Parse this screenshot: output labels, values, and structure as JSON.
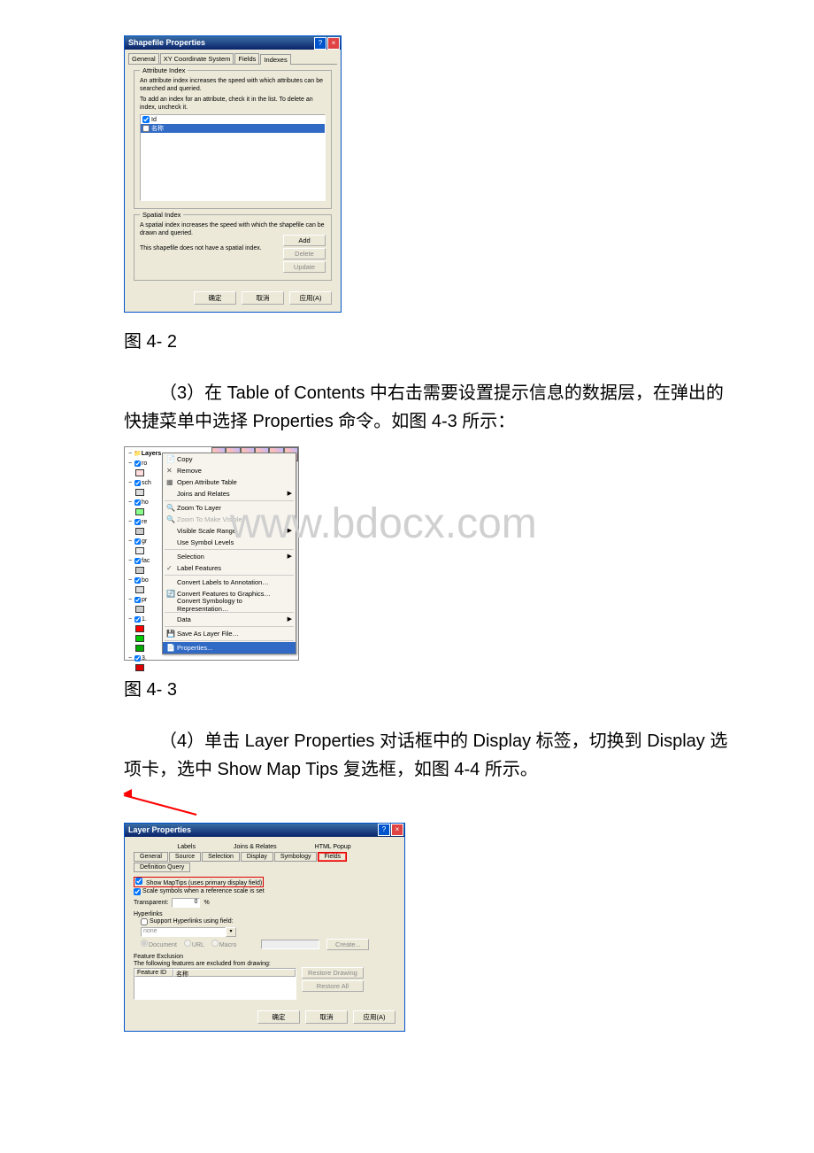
{
  "watermark": "www.bdocx.com",
  "captions": {
    "fig1": "图 4- 2",
    "fig2": "图 4- 3"
  },
  "para1": "（3）在 Table of Contents 中右击需要设置提示信息的数据层，在弹出的快捷菜单中选择 Properties 命令。如图 4-3 所示：",
  "para2": "（4）单击 Layer Properties 对话框中的 Display 标签，切换到 Display 选项卡，选中 Show Map Tips 复选框，如图 4-4 所示。",
  "dlg1": {
    "title": "Shapefile Properties",
    "tabs": {
      "t1": "General",
      "t2": "XY Coordinate System",
      "t3": "Fields",
      "t4": "Indexes"
    },
    "attr_legend": "Attribute Index",
    "attr_desc1": "An attribute index increases the speed with which attributes can be searched and queried.",
    "attr_desc2": "To add an index for an attribute, check it in the list. To delete an index, uncheck it.",
    "li1": "Id",
    "li2": "名称",
    "sp_legend": "Spatial Index",
    "sp_desc": "A spatial index increases the speed with which the shapefile can be drawn and queried.",
    "sp_status": "This shapefile does not have a spatial index.",
    "btn_add": "Add",
    "btn_delete": "Delete",
    "btn_update": "Update",
    "btn_ok": "确定",
    "btn_cancel": "取消",
    "btn_apply": "应用(A)"
  },
  "toc": {
    "root": "Layers",
    "items": [
      "ro",
      "sch",
      "ho",
      "re",
      "gr",
      "fac",
      "bo",
      "pr",
      "1.",
      "3."
    ]
  },
  "menu": {
    "copy": "Copy",
    "remove": "Remove",
    "oat": "Open Attribute Table",
    "jr": "Joins and Relates",
    "ztl": "Zoom To Layer",
    "ztv": "Zoom To Make Visible",
    "vsr": "Visible Scale Range",
    "usl": "Use Symbol Levels",
    "sel": "Selection",
    "lf": "Label Features",
    "cla": "Convert Labels to Annotation…",
    "cfg": "Convert Features to Graphics…",
    "csr": "Convert Symbology to Representation…",
    "data": "Data",
    "salf": "Save As Layer File…",
    "prop": "Properties..."
  },
  "dlg2": {
    "title": "Layer Properties",
    "tabs_top": {
      "labels": "Labels",
      "jr": "Joins & Relates",
      "html": "HTML Popup"
    },
    "tabs_bot": {
      "gen": "General",
      "src": "Source",
      "sel": "Selection",
      "disp": "Display",
      "sym": "Symbology",
      "flds": "Fields",
      "dq": "Definition Query"
    },
    "show_maptips": "Show MapTips (uses primary display field)",
    "scale_symbols": "Scale symbols when a reference scale is set",
    "transparent": "Transparent:",
    "transparent_val": "0",
    "pct": "%",
    "hyperlinks": "Hyperlinks",
    "support_hl": "Support Hyperlinks using field:",
    "combo_val": "none",
    "r_doc": "Document",
    "r_url": "URL",
    "r_macro": "Macro",
    "btn_create": "Create...",
    "fe_legend": "Feature Exclusion",
    "fe_desc": "The following features are excluded from drawing:",
    "col1": "Feature ID",
    "col2": "名称",
    "btn_restore": "Restore Drawing",
    "btn_restoreall": "Restore All",
    "btn_ok": "确定",
    "btn_cancel": "取消",
    "btn_apply": "应用(A)"
  }
}
